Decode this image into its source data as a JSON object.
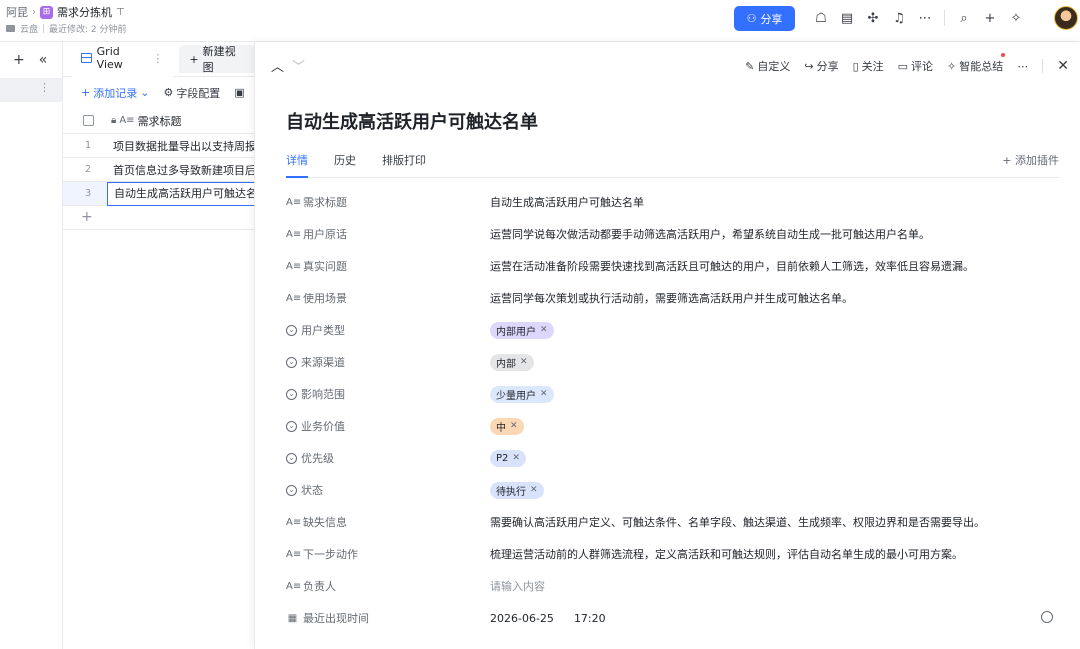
{
  "topbar": {
    "breadcrumb_root": "阿昆",
    "doc_title": "需求分拣机",
    "location": "云盘",
    "last_modified": "最近修改: 2 分钟前",
    "share_label": "分享"
  },
  "grid": {
    "view_tab": "Grid View",
    "new_view": "新建视图",
    "add_record": "添加记录",
    "field_config": "字段配置",
    "column_header": "需求标题",
    "rows": [
      {
        "num": "1",
        "title": "项目数据批量导出以支持周报汇总"
      },
      {
        "num": "2",
        "title": "首页信息过多导致新建项目后"
      },
      {
        "num": "3",
        "title": "自动生成高活跃用户可触达名单"
      }
    ]
  },
  "panel": {
    "actions": {
      "customize": "自定义",
      "share": "分享",
      "follow": "关注",
      "comment": "评论",
      "summary": "智能总结"
    },
    "title": "自动生成高活跃用户可触达名单",
    "tabs": [
      "详情",
      "历史",
      "排版打印"
    ],
    "add_plugin": "添加插件",
    "fields": [
      {
        "label": "需求标题",
        "icon": "text",
        "value": "自动生成高活跃用户可触达名单"
      },
      {
        "label": "用户原话",
        "icon": "text",
        "value": "运营同学说每次做活动都要手动筛选高活跃用户，希望系统自动生成一批可触达用户名单。"
      },
      {
        "label": "真实问题",
        "icon": "text",
        "value": "运营在活动准备阶段需要快速找到高活跃且可触达的用户，目前依赖人工筛选，效率低且容易遗漏。"
      },
      {
        "label": "使用场景",
        "icon": "text",
        "value": "运营同学每次策划或执行活动前，需要筛选高活跃用户并生成可触达名单。"
      },
      {
        "label": "用户类型",
        "icon": "select",
        "chip": "内部用户",
        "chip_color": "#ddd7fb"
      },
      {
        "label": "来源渠道",
        "icon": "select",
        "chip": "内部",
        "chip_color": "#e4e5e7"
      },
      {
        "label": "影响范围",
        "icon": "select",
        "chip": "少量用户",
        "chip_color": "#dbe8fb"
      },
      {
        "label": "业务价值",
        "icon": "select",
        "chip": "中",
        "chip_color": "#fcd7b4"
      },
      {
        "label": "优先级",
        "icon": "select",
        "chip": "P2",
        "chip_color": "#d8e3fb"
      },
      {
        "label": "状态",
        "icon": "select",
        "chip": "待执行",
        "chip_color": "#d8e3fb"
      },
      {
        "label": "缺失信息",
        "icon": "text",
        "value": "需要确认高活跃用户定义、可触达条件、名单字段、触达渠道、生成频率、权限边界和是否需要导出。"
      },
      {
        "label": "下一步动作",
        "icon": "text",
        "value": "梳理运营活动前的人群筛选流程，定义高活跃和可触达规则，评估自动名单生成的最小可用方案。"
      },
      {
        "label": "负责人",
        "icon": "text",
        "placeholder": "请输入内容"
      },
      {
        "label": "最近出现时间",
        "icon": "date",
        "date": "2026-06-25",
        "time": "17:20"
      }
    ]
  }
}
